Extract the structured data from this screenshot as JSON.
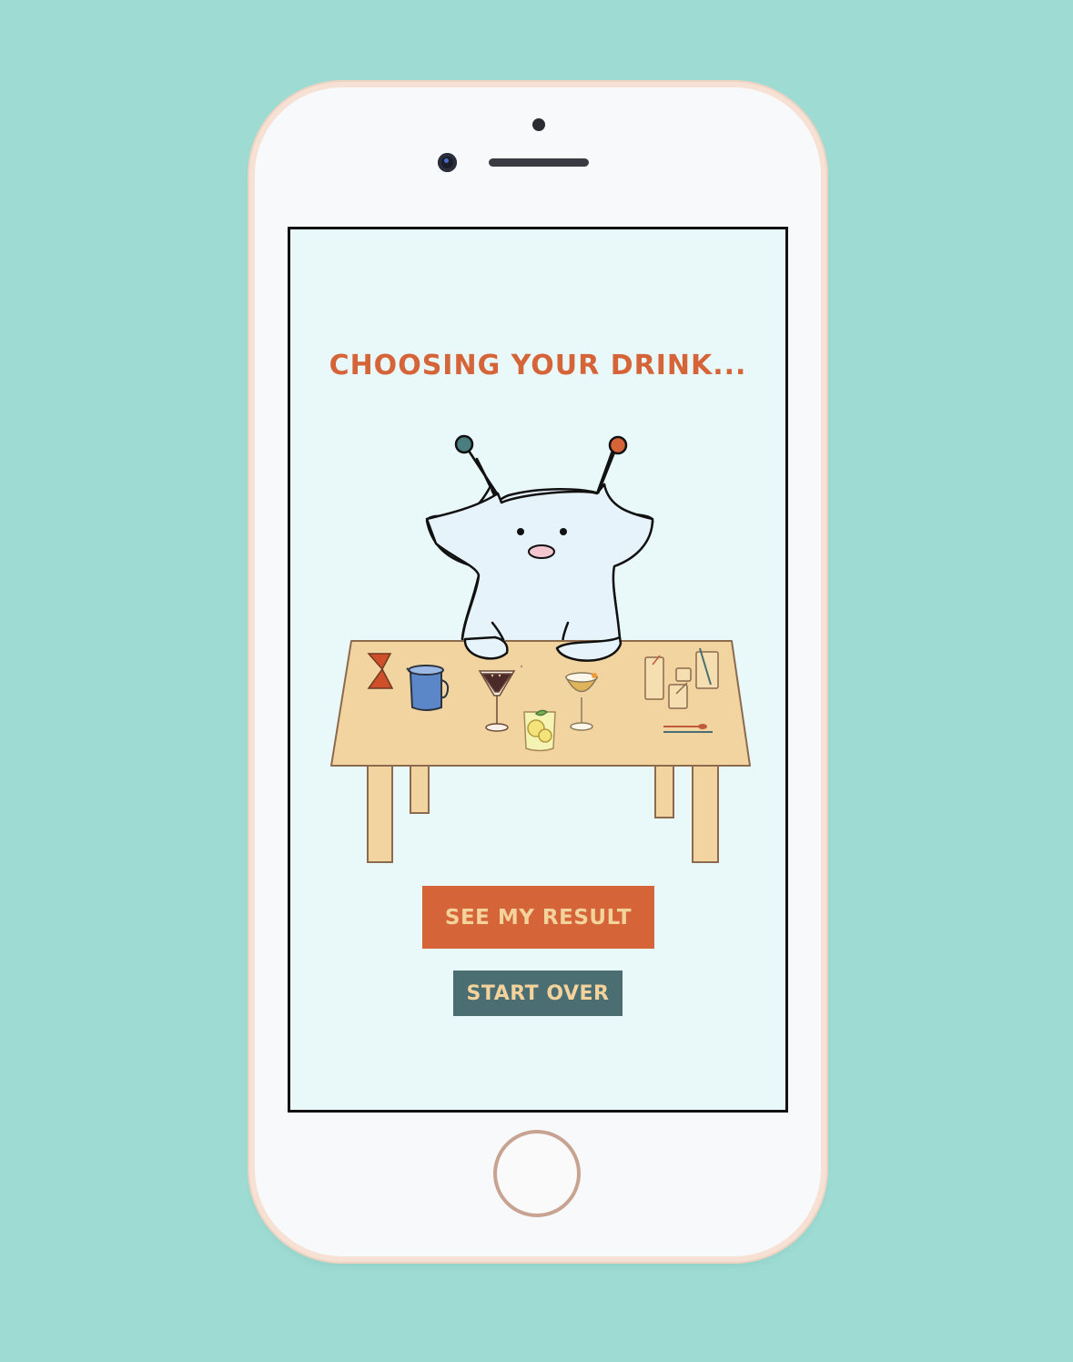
{
  "screen": {
    "title": "CHOOSING YOUR DRINK..."
  },
  "buttons": {
    "see_result_label": "SEE MY RESULT",
    "start_over_label": "START OVER"
  },
  "colors": {
    "background": "#9ddbd3",
    "screen_bg": "#e9f8f9",
    "accent_orange": "#d56438",
    "accent_teal": "#4a6e72",
    "button_text": "#f3d29c",
    "table": "#f1d49f"
  },
  "icons": [
    "creature-mascot",
    "table",
    "jigger-icon",
    "pitcher-icon",
    "martini-glass-icon",
    "lemon-drink-glass-icon",
    "coupe-glass-icon",
    "glasses-group-icon",
    "bar-spoon-icon"
  ]
}
